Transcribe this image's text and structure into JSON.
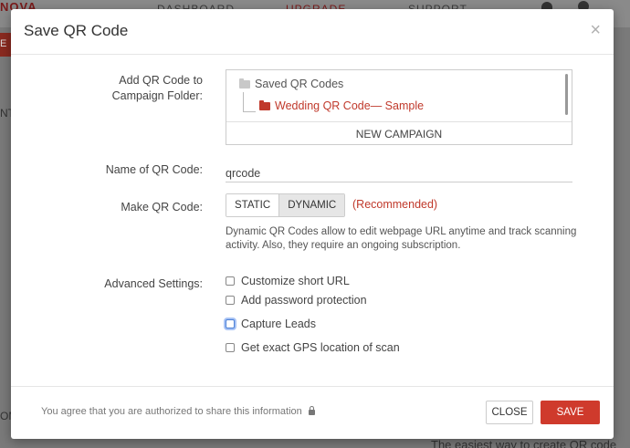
{
  "background": {
    "logo_fragment": "NOVA",
    "nav": {
      "dashboard": "DASHBOARD",
      "upgrade": "UPGRADE",
      "support": "SUPPORT"
    },
    "redbar_fragment": "E",
    "left_fragment_1": "NT",
    "left_fragment_2": "OM",
    "bottom_fragment": "The easiest way to create QR code"
  },
  "modal": {
    "title": "Save QR Code",
    "close_symbol": "×",
    "folder": {
      "label": "Add QR Code to Campaign Folder:",
      "root": "Saved QR Codes",
      "child": "Wedding QR Code— Sample",
      "new_campaign": "NEW CAMPAIGN"
    },
    "name": {
      "label": "Name of QR Code:",
      "value": "qrcode"
    },
    "make": {
      "label": "Make QR Code:",
      "static": "STATIC",
      "dynamic": "DYNAMIC",
      "selected": "DYNAMIC",
      "recommended": "(Recommended)",
      "description": "Dynamic QR Codes allow to edit webpage URL anytime and track scanning activity. Also, they require an ongoing subscription."
    },
    "advanced": {
      "label": "Advanced Settings:",
      "options": [
        "Customize short URL",
        "Add password protection",
        "Capture Leads",
        "Get exact GPS location of scan"
      ]
    },
    "footer": {
      "note": "You agree that you are authorized to share this information",
      "close_label": "CLOSE",
      "save_label": "SAVE"
    }
  }
}
